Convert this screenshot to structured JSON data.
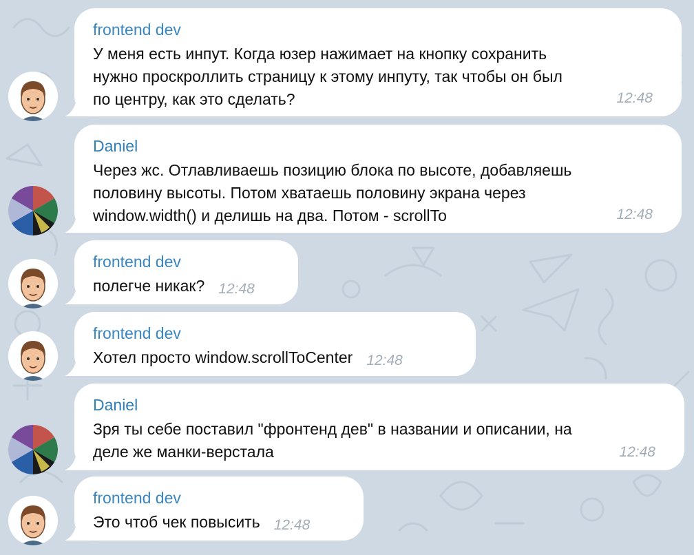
{
  "chat": {
    "messages": [
      {
        "sender": "frontend dev",
        "lines": [
          "У меня есть инпут. Когда юзер нажимает на кнопку сохранить",
          "нужно проскроллить страницу к этому инпуту, так чтобы он был",
          "по центру, как это сделать?"
        ],
        "time": "12:48"
      },
      {
        "sender": "Daniel",
        "lines": [
          "Через жс. Отлавливаешь позицию блока по высоте, добавляешь",
          "половину высоты. Потом хватаешь половину экрана через",
          "window.width() и делишь на два. Потом - scrollTo"
        ],
        "time": "12:48"
      },
      {
        "sender": "frontend dev",
        "lines": [
          "полегче никак?"
        ],
        "time": "12:48"
      },
      {
        "sender": "frontend dev",
        "lines": [
          "Хотел просто window.scrollToCenter"
        ],
        "time": "12:48"
      },
      {
        "sender": "Daniel",
        "lines": [
          "Зря ты себе поставил \"фронтенд дев\" в названии и описании, на",
          "деле же манки-верстала"
        ],
        "time": "12:48"
      },
      {
        "sender": "frontend dev",
        "lines": [
          "Это чтоб чек повысить"
        ],
        "time": "12:48"
      }
    ]
  },
  "colors": {
    "wallpaper": "#cfd9e3",
    "bubble": "#ffffff",
    "sender_frontend": "#3a86c0",
    "sender_daniel": "#2f7fb6",
    "time": "#a3adb7"
  },
  "icons": {
    "frontend_avatar": "cartoon-man-avatar",
    "daniel_avatar": "color-wheel-avatar"
  }
}
